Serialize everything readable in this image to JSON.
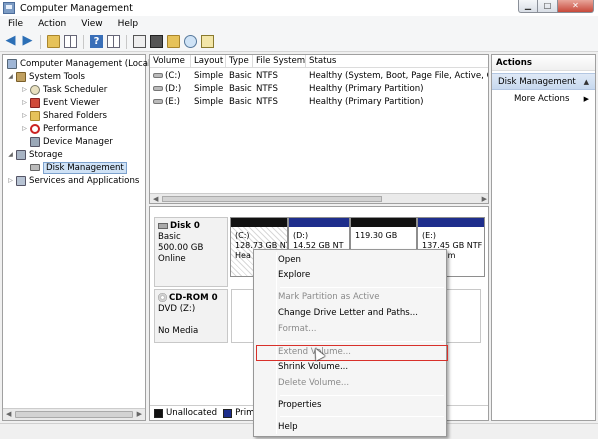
{
  "window": {
    "title": "Computer Management"
  },
  "menu": [
    "File",
    "Action",
    "View",
    "Help"
  ],
  "tree": {
    "items": [
      {
        "label": "Computer Management (Local",
        "icon": "computer-icon"
      },
      {
        "label": "System Tools",
        "icon": "tools-icon"
      },
      {
        "label": "Task Scheduler",
        "icon": "clock-icon"
      },
      {
        "label": "Event Viewer",
        "icon": "event-viewer-icon"
      },
      {
        "label": "Shared Folders",
        "icon": "shared-folder-icon"
      },
      {
        "label": "Performance",
        "icon": "no-entry-icon"
      },
      {
        "label": "Device Manager",
        "icon": "device-manager-icon"
      },
      {
        "label": "Storage",
        "icon": "storage-icon"
      },
      {
        "label": "Disk Management",
        "icon": "disk-icon"
      },
      {
        "label": "Services and Applications",
        "icon": "services-icon"
      }
    ]
  },
  "volumes": {
    "headers": [
      "Volume",
      "Layout",
      "Type",
      "File System",
      "Status"
    ],
    "rows": [
      [
        "(C:)",
        "Simple",
        "Basic",
        "NTFS",
        "Healthy (System, Boot, Page File, Active, Cr"
      ],
      [
        "(D:)",
        "Simple",
        "Basic",
        "NTFS",
        "Healthy (Primary Partition)"
      ],
      [
        "(E:)",
        "Simple",
        "Basic",
        "NTFS",
        "Healthy (Primary Partition)"
      ]
    ]
  },
  "disks": {
    "disk0": {
      "name": "Disk 0",
      "type": "Basic",
      "size": "500.00 GB",
      "status": "Online"
    },
    "cdrom0": {
      "name": "CD-ROM 0",
      "drive": "DVD (Z:)",
      "media": "No Media"
    },
    "partitions": [
      {
        "label": "(C:)",
        "size": "128.73 GB NT",
        "status": "Hea"
      },
      {
        "label": "(D:)",
        "size": "14.52 GB NT",
        "status": ""
      },
      {
        "label": "",
        "size": "119.30 GB",
        "status": ""
      },
      {
        "label": "(E:)",
        "size": "137.45 GB NTF",
        "status": "hy (Prim"
      }
    ]
  },
  "legend": {
    "unallocated": "Unallocated",
    "primary": "Prima",
    "unallocated_color": "#111111",
    "primary_color": "#1e2e8c"
  },
  "actions": {
    "title": "Actions",
    "section": "Disk Management",
    "more": "More Actions"
  },
  "context_menu": {
    "items": [
      {
        "label": "Open",
        "enabled": true
      },
      {
        "label": "Explore",
        "enabled": true
      },
      {
        "label": "Mark Partition as Active",
        "enabled": false
      },
      {
        "label": "Change Drive Letter and Paths...",
        "enabled": true
      },
      {
        "label": "Format...",
        "enabled": false
      },
      {
        "label": "Extend Volume...",
        "enabled": false
      },
      {
        "label": "Shrink Volume...",
        "enabled": true
      },
      {
        "label": "Delete Volume...",
        "enabled": false
      },
      {
        "label": "Properties",
        "enabled": true
      },
      {
        "label": "Help",
        "enabled": true
      }
    ],
    "highlight_color": "#d8302a"
  }
}
